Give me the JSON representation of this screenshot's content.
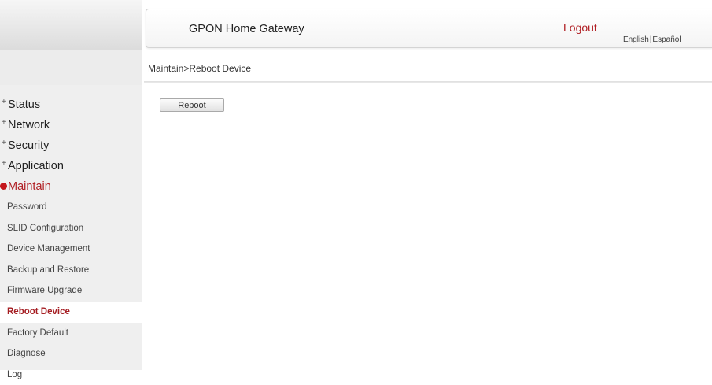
{
  "header": {
    "title": "GPON Home Gateway",
    "logout": "Logout",
    "lang_english": "English",
    "lang_separator": "|",
    "lang_spanish": "Español"
  },
  "breadcrumb": "Maintain>Reboot Device",
  "menu": {
    "status": "Status",
    "network": "Network",
    "security": "Security",
    "application": "Application",
    "maintain": "Maintain"
  },
  "submenu": {
    "password": "Password",
    "slid": "SLID Configuration",
    "device_mgmt": "Device Management",
    "backup": "Backup and Restore",
    "firmware": "Firmware Upgrade",
    "reboot": "Reboot Device",
    "factory": "Factory Default",
    "diagnose": "Diagnose",
    "log": "Log"
  },
  "content": {
    "reboot_button": "Reboot"
  },
  "colors": {
    "accent": "#b01e23",
    "sidebar_bg": "#efefef"
  },
  "icons": {
    "expand": "plus-icon",
    "collapse": "minus-circle-icon"
  }
}
